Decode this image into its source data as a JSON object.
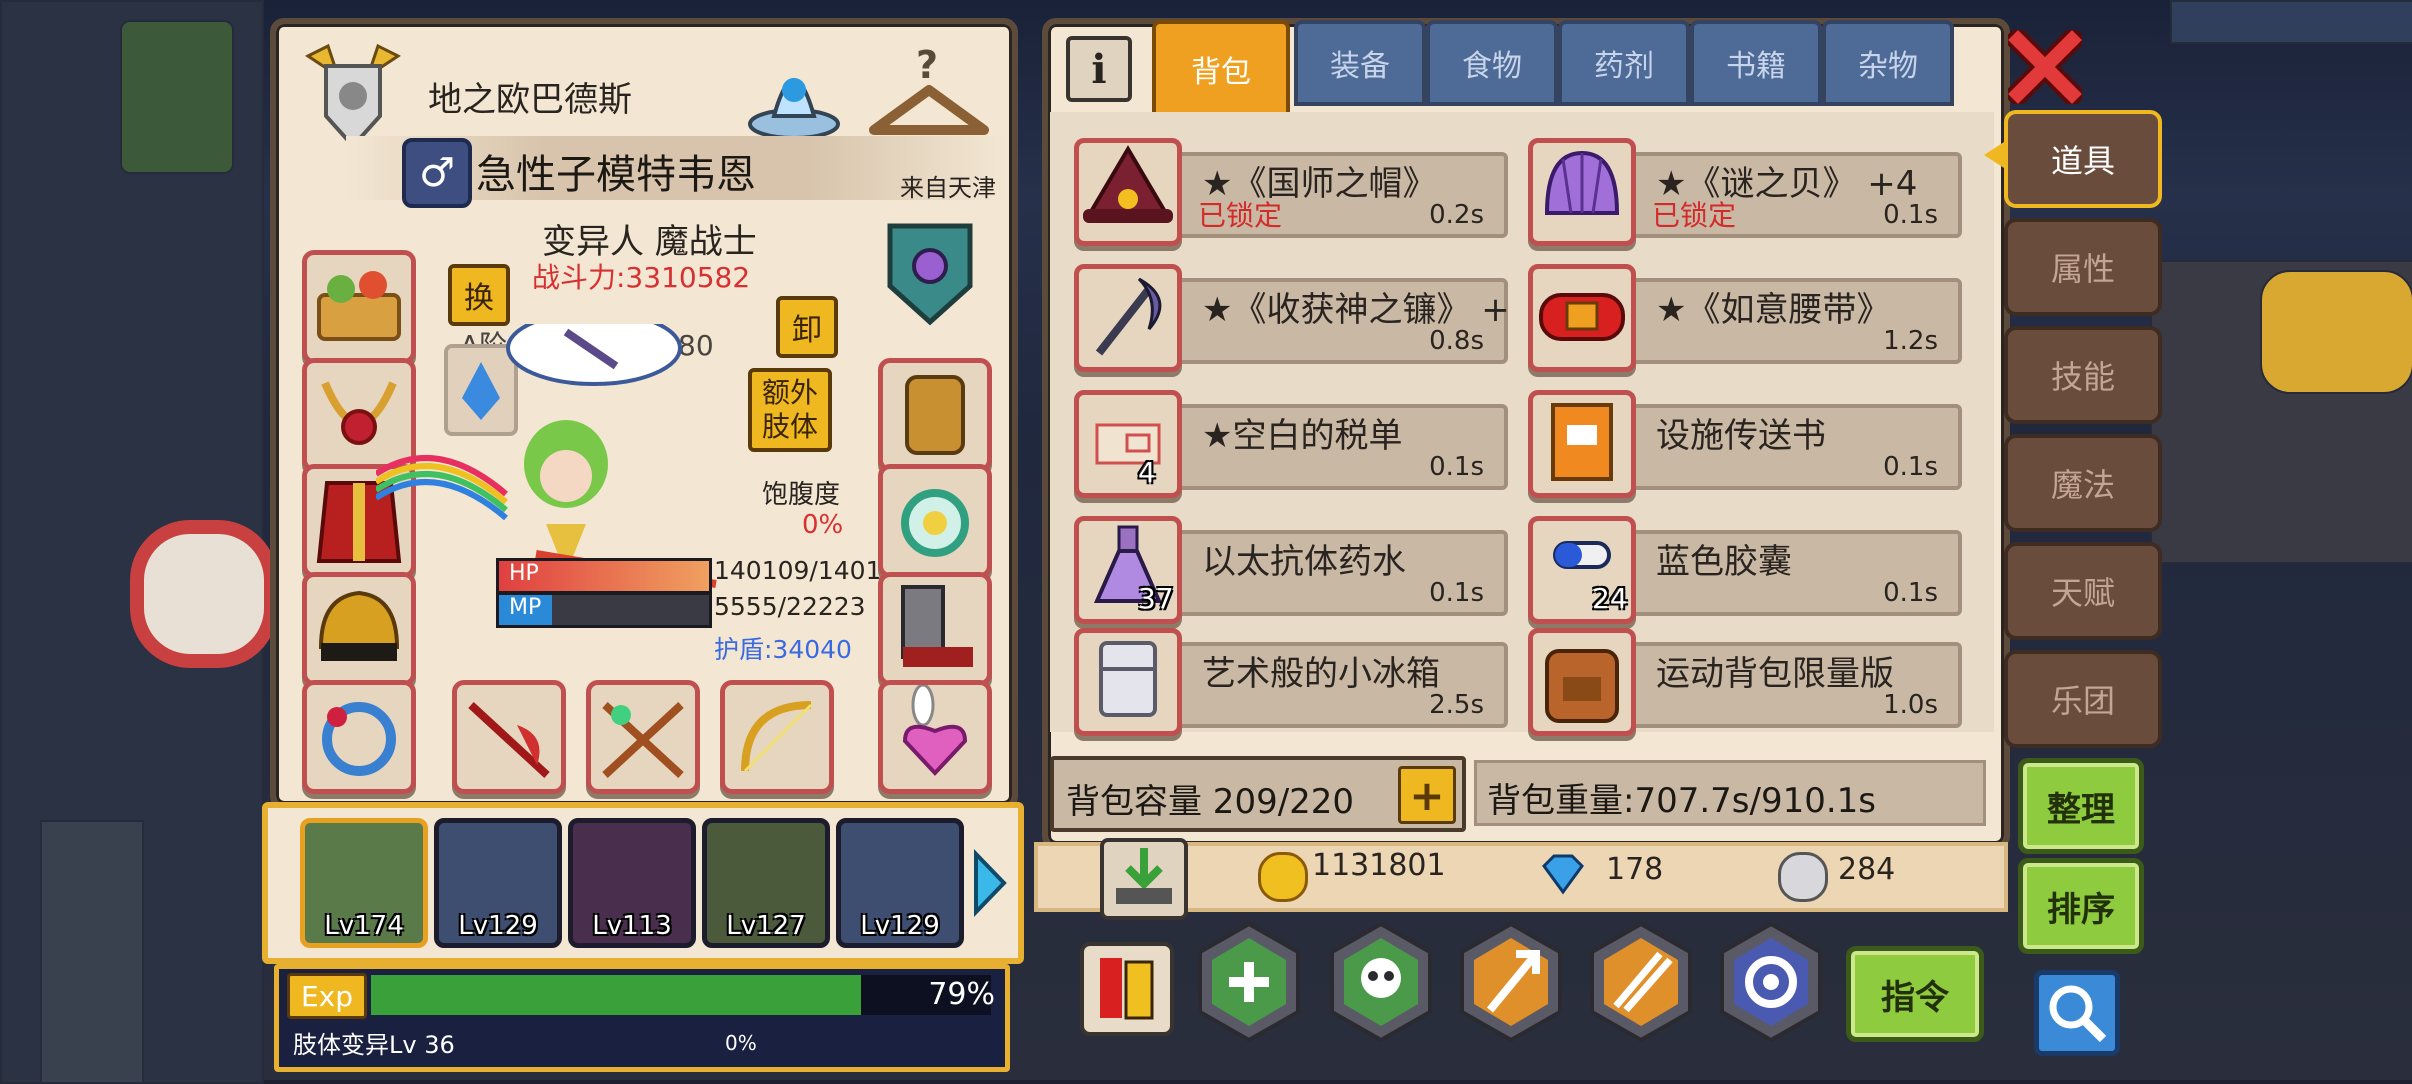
{
  "character": {
    "title": "地之欧巴德斯",
    "name": "急性子模特韦恩",
    "origin": "来自天津",
    "class": "变异人 魔战士",
    "power": "战斗力:3310582",
    "weapon_line": "A阶 地狱使者 Lv 80",
    "swap_label": "换",
    "unequip_label": "卸",
    "extra_limb_label": "额外肢体",
    "satiety_label": "饱腹度",
    "satiety_value": "0%",
    "hp_label": "HP",
    "hp_value": "140109/1401",
    "mp_label": "MP",
    "mp_value": "5555/22223",
    "shield": "护盾:34040",
    "hp_fraction": 1.0,
    "mp_fraction": 0.25
  },
  "party": [
    {
      "level": "Lv174"
    },
    {
      "level": "Lv129"
    },
    {
      "level": "Lv113"
    },
    {
      "level": "Lv127"
    },
    {
      "level": "Lv129"
    }
  ],
  "exp": {
    "label": "Exp",
    "percent": "79%",
    "fraction": 0.79,
    "mutation_label": "肢体变异Lv 36",
    "mutation_percent": "0%"
  },
  "inventory": {
    "tabs": [
      "背包",
      "装备",
      "食物",
      "药剂",
      "书籍",
      "杂物"
    ],
    "active_tab": "背包",
    "items": [
      {
        "name": "★《国师之帽》",
        "lock": "已锁定",
        "weight": "0.2s",
        "count": "",
        "icon": "wizard-hat-icon"
      },
      {
        "name": "★《谜之贝》 +4",
        "lock": "已锁定",
        "weight": "0.1s",
        "count": "",
        "icon": "shell-icon"
      },
      {
        "name": "★《收获神之镰》 +",
        "lock": "",
        "weight": "0.8s",
        "count": "",
        "icon": "scythe-icon"
      },
      {
        "name": "★《如意腰带》",
        "lock": "",
        "weight": "1.2s",
        "count": "",
        "icon": "belt-icon"
      },
      {
        "name": "★空白的税单",
        "lock": "",
        "weight": "0.1s",
        "count": "4",
        "icon": "tax-form-icon"
      },
      {
        "name": "设施传送书",
        "lock": "",
        "weight": "0.1s",
        "count": "",
        "icon": "book-icon"
      },
      {
        "name": "以太抗体药水",
        "lock": "",
        "weight": "0.1s",
        "count": "37",
        "icon": "potion-icon"
      },
      {
        "name": "蓝色胶囊",
        "lock": "",
        "weight": "0.1s",
        "count": "24",
        "icon": "capsule-icon"
      },
      {
        "name": "艺术般的小冰箱",
        "lock": "",
        "weight": "2.5s",
        "count": "",
        "icon": "fridge-icon"
      },
      {
        "name": "运动背包限量版",
        "lock": "",
        "weight": "1.0s",
        "count": "",
        "icon": "backpack-icon"
      }
    ],
    "capacity": "背包容量 209/220",
    "weight": "背包重量:707.7s/910.1s"
  },
  "currency": {
    "gold": "1131801",
    "diamond": "178",
    "silver": "284"
  },
  "side_tabs": [
    "道具",
    "属性",
    "技能",
    "魔法",
    "天赋",
    "乐团"
  ],
  "buttons": {
    "organize": "整理",
    "sort": "排序",
    "command": "指令"
  },
  "colors": {
    "panel": "#f3e7d3",
    "slot_border": "#c05050",
    "active_tab": "#f0a020",
    "tab": "#4e6a96",
    "green_button": "#8ecb3e",
    "close": "#e23a3a",
    "exp_bar": "#3aa03a",
    "hp_bar": "#e04040",
    "mp_bar": "#2a8ad8"
  }
}
